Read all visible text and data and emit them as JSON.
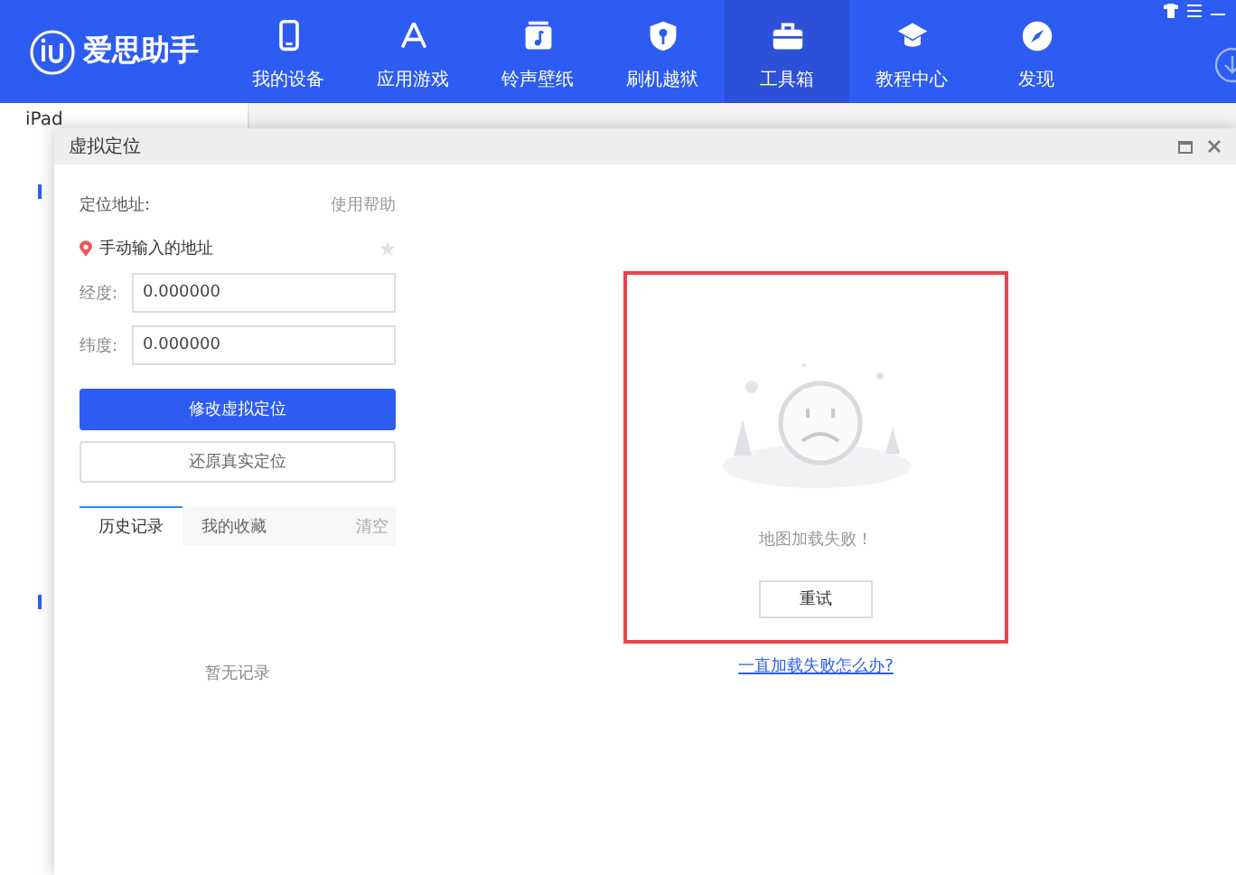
{
  "app": {
    "logo_text": "爱思助手"
  },
  "nav": [
    {
      "label": "我的设备",
      "selected": false
    },
    {
      "label": "应用游戏",
      "selected": false
    },
    {
      "label": "铃声壁纸",
      "selected": false
    },
    {
      "label": "刷机越狱",
      "selected": false
    },
    {
      "label": "工具箱",
      "selected": true
    },
    {
      "label": "教程中心",
      "selected": false
    },
    {
      "label": "发现",
      "selected": false
    }
  ],
  "sidebar": {
    "device_name": "iPad"
  },
  "dialog": {
    "title": "虚拟定位",
    "address_label": "定位地址:",
    "help_link": "使用帮助",
    "address": "手动输入的地址",
    "fields": [
      {
        "label": "经度:",
        "value": "0.000000"
      },
      {
        "label": "纬度:",
        "value": "0.000000"
      }
    ],
    "buttons": [
      {
        "label": "修改虚拟定位",
        "kind": "primary"
      },
      {
        "label": "还原真实定位",
        "kind": "secondary"
      }
    ],
    "tabs": [
      {
        "label": "历史记录",
        "selected": true
      },
      {
        "label": "我的收藏",
        "selected": false
      }
    ],
    "clear_link": "清空",
    "empty_text": "暂无记录",
    "map": {
      "error_text": "地图加载失败！",
      "retry": "重试",
      "help_link": "一直加载失败怎么办?"
    }
  }
}
